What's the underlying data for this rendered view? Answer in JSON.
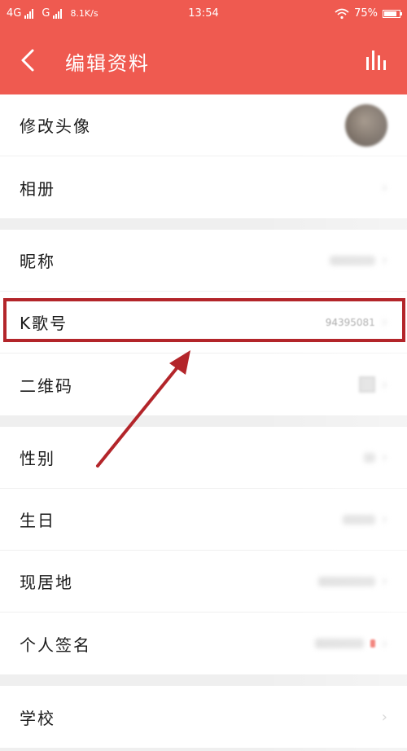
{
  "status_bar": {
    "network1": "4G",
    "network2": "G",
    "speed": "8.1K/s",
    "time": "13:54",
    "battery": "75%"
  },
  "header": {
    "title": "编辑资料",
    "back_icon": "chevron-left-icon",
    "stats_icon": "bar-chart-icon"
  },
  "profile": {
    "avatar_label": "修改头像",
    "album_label": "相册",
    "nickname_label": "昵称",
    "kge_id_label": "K歌号",
    "kge_id_value": "94395081",
    "qrcode_label": "二维码",
    "gender_label": "性别",
    "birthday_label": "生日",
    "location_label": "现居地",
    "signature_label": "个人签名",
    "school_label": "学校"
  },
  "colors": {
    "header_bg": "#ef5a50",
    "annotation": "#b3252a"
  }
}
